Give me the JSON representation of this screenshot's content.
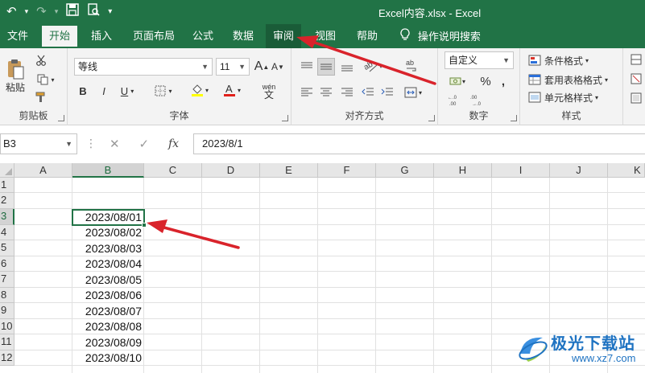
{
  "titlebar": {
    "title": "Excel内容.xlsx  -  Excel",
    "undo_icon": "↶",
    "redo_icon": "↷",
    "save_icon": "💾",
    "preview_icon": "🔍",
    "more_icon": "▾"
  },
  "tabs": {
    "file": "文件",
    "home": "开始",
    "insert": "插入",
    "page_layout": "页面布局",
    "formulas": "公式",
    "data": "数据",
    "review": "审阅",
    "view": "视图",
    "help": "帮助",
    "tell_me": "操作说明搜索"
  },
  "ribbon": {
    "clipboard": {
      "label": "剪贴板",
      "paste": "粘贴"
    },
    "font": {
      "label": "字体",
      "font_name": "等线",
      "font_size": "11",
      "bold": "B",
      "italic": "I",
      "underline": "U",
      "grow": "A",
      "shrink": "A",
      "phonetic": "wén"
    },
    "alignment": {
      "label": "对齐方式"
    },
    "number": {
      "label": "数字",
      "format": "自定义",
      "percent": "%",
      "comma": ","
    },
    "styles": {
      "label": "样式",
      "conditional": "条件格式",
      "table": "套用表格格式",
      "cell_styles": "单元格样式"
    }
  },
  "formula_bar": {
    "name_box": "B3",
    "cancel": "✕",
    "enter": "✓",
    "fx": "fx",
    "value": "2023/8/1"
  },
  "grid": {
    "columns": [
      "A",
      "B",
      "C",
      "D",
      "E",
      "F",
      "G",
      "H",
      "I",
      "J",
      "K"
    ],
    "rows": [
      "1",
      "2",
      "3",
      "4",
      "5",
      "6",
      "7",
      "8",
      "9",
      "10",
      "11",
      "12"
    ],
    "selected_cell": "B3",
    "column_b_values": [
      "",
      "",
      "2023/08/01",
      "2023/08/02",
      "2023/08/03",
      "2023/08/04",
      "2023/08/05",
      "2023/08/06",
      "2023/08/07",
      "2023/08/08",
      "2023/08/09",
      "2023/08/10"
    ]
  },
  "watermark": {
    "brand": "极光下载站",
    "url": "www.xz7.com"
  },
  "colors": {
    "accent": "#217346",
    "arrow": "#d9232b",
    "watermark": "#1f73c2"
  }
}
